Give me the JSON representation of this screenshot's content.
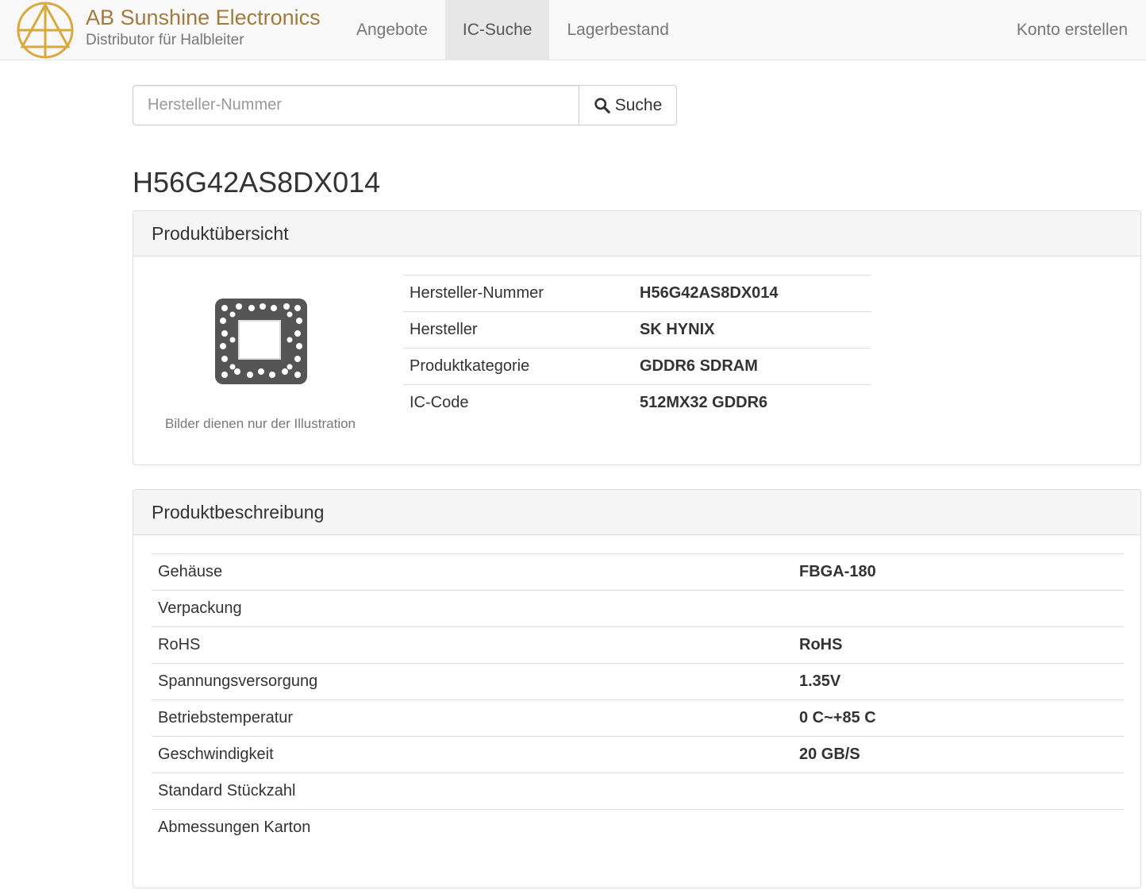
{
  "brand": {
    "name": "AB Sunshine Electronics",
    "subtitle": "Distributor für Halbleiter",
    "logo_color": "#d9a93e"
  },
  "nav": {
    "items": [
      {
        "label": "Angebote",
        "active": false
      },
      {
        "label": "IC-Suche",
        "active": true
      },
      {
        "label": "Lagerbestand",
        "active": false
      }
    ],
    "account_label": "Konto erstellen"
  },
  "search": {
    "placeholder": "Hersteller-Nummer",
    "value": "",
    "button_label": "Suche",
    "icon": "search-icon"
  },
  "page_title": "H56G42AS8DX014",
  "overview": {
    "heading": "Produktübersicht",
    "image_caption": "Bilder dienen nur der Illustration",
    "image_icon": "chip-icon",
    "rows": [
      {
        "label": "Hersteller-Nummer",
        "value": "H56G42AS8DX014"
      },
      {
        "label": "Hersteller",
        "value": "SK HYNIX"
      },
      {
        "label": "Produktkategorie",
        "value": "GDDR6 SDRAM"
      },
      {
        "label": "IC-Code",
        "value": "512MX32 GDDR6"
      }
    ]
  },
  "description": {
    "heading": "Produktbeschreibung",
    "rows": [
      {
        "label": "Gehäuse",
        "value": "FBGA-180"
      },
      {
        "label": "Verpackung",
        "value": ""
      },
      {
        "label": "RoHS",
        "value": "RoHS"
      },
      {
        "label": "Spannungsversorgung",
        "value": "1.35V"
      },
      {
        "label": "Betriebstemperatur",
        "value": "0 C~+85 C"
      },
      {
        "label": "Geschwindigkeit",
        "value": "20 GB/S"
      },
      {
        "label": "Standard Stückzahl",
        "value": ""
      },
      {
        "label": "Abmessungen Karton",
        "value": ""
      }
    ]
  }
}
